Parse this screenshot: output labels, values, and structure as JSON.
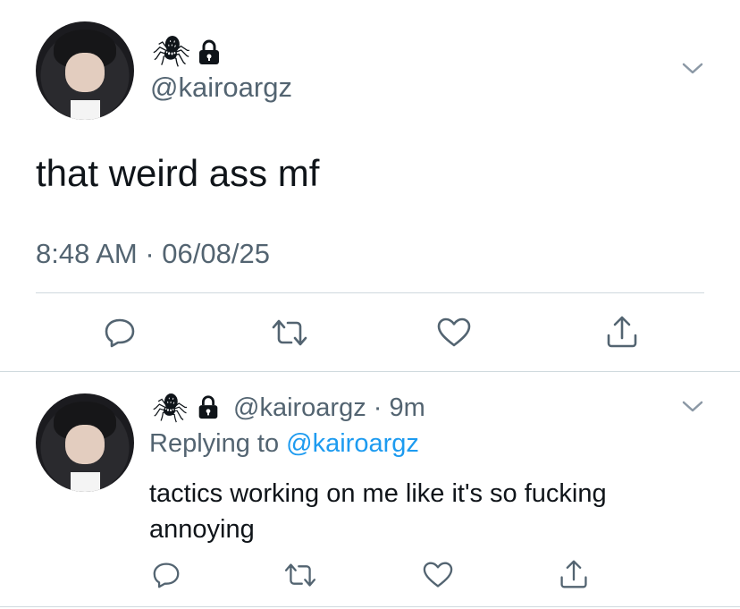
{
  "main_tweet": {
    "emoji": "🕷",
    "handle": "@kairoargz",
    "text": "that weird ass mf",
    "timestamp": "8:48 AM · 06/08/25"
  },
  "reply": {
    "emoji": "🕷",
    "handle": "@kairoargz",
    "dot": "·",
    "time": "9m",
    "replying_prefix": "Replying to",
    "replying_handle": "@kairoargz",
    "text_line1": "tactics working on me like it's so fucking",
    "text_line2": "annoying"
  },
  "icons": {
    "reply": "comment-icon",
    "retweet": "retweet-icon",
    "like": "heart-icon",
    "share": "share-icon",
    "more": "chevron-down-icon",
    "lock": "lock-icon"
  },
  "colors": {
    "text": "#0f1419",
    "secondary": "#536471",
    "link": "#1d9bf0",
    "divider": "#cfd9de"
  }
}
